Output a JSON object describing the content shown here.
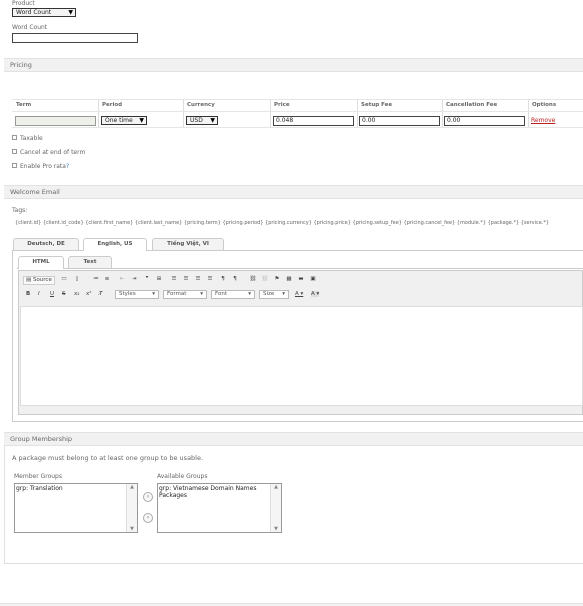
{
  "product": {
    "label": "Product",
    "value": "Word Count"
  },
  "word_count": {
    "label": "Word Count",
    "value": ""
  },
  "pricing": {
    "title": "Pricing",
    "columns": [
      "Term",
      "Period",
      "Currency",
      "Price",
      "Setup Fee",
      "Cancellation Fee",
      "Options"
    ],
    "row": {
      "term": "",
      "period": "One time",
      "currency": "USD",
      "price": "0.048",
      "setup_fee": "0.00",
      "cancellation_fee": "0.00",
      "remove": "Remove"
    }
  },
  "options": {
    "taxable": "Taxable",
    "cancel_end": "Cancel at end of term",
    "pro_rata": "Enable Pro rata",
    "help": "?"
  },
  "welcome_email": {
    "title": "Welcome Email",
    "tags_label": "Tags:",
    "tags": "{client.id} {client.id_code} {client.first_name} {client.last_name} {pricing.term} {pricing.period} {pricing.currency} {pricing.price} {pricing.setup_fee} {pricing.cancel_fee} {module.*} {package.*} {service.*}",
    "lang_tabs": [
      "Deutsch, DE",
      "English, US",
      "Tiếng Việt, VI"
    ],
    "format_tabs": [
      "HTML",
      "Text"
    ],
    "toolbar": {
      "source": "Source",
      "styles": "Styles",
      "format": "Format",
      "font": "Font",
      "size": "Size"
    }
  },
  "group_membership": {
    "title": "Group Membership",
    "note": "A package must belong to at least one group to be usable.",
    "member_label": "Member Groups",
    "available_label": "Available Groups",
    "member_items": [
      "grp: Translation"
    ],
    "available_items": [
      "grp: Vietnamese Domain Names",
      "Packages"
    ]
  }
}
